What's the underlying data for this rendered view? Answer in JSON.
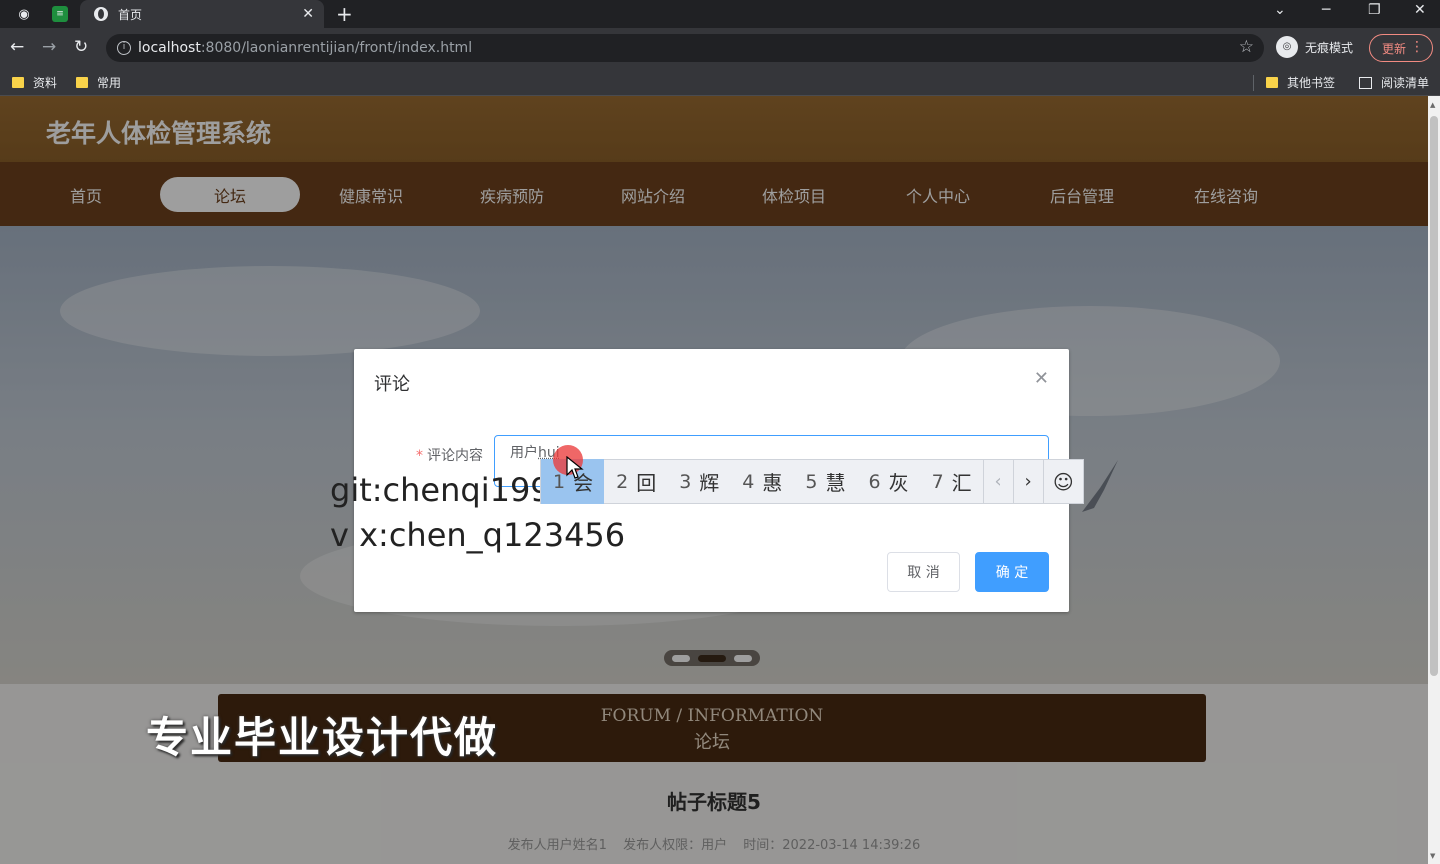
{
  "browser": {
    "tab_title": "首页",
    "url_host": "localhost",
    "url_path": ":8080/laonianrentijian/front/index.html",
    "incognito_label": "无痕模式",
    "update_label": "更新",
    "bookmarks": [
      "资料",
      "常用",
      "其他书签",
      "阅读清单"
    ]
  },
  "site": {
    "title": "老年人体检管理系统",
    "nav": [
      "首页",
      "论坛",
      "健康常识",
      "疾病预防",
      "网站介绍",
      "体检项目",
      "个人中心",
      "后台管理",
      "在线咨询"
    ],
    "active_nav": "论坛"
  },
  "forum": {
    "heading_en": "FORUM / INFORMATION",
    "heading_zh": "论坛",
    "post_title": "帖子标题5",
    "meta": {
      "publisher": "发布人用户姓名1",
      "role": "发布人权限：用户",
      "time": "时间：2022-03-14 14:39:26"
    }
  },
  "dialog": {
    "title": "评论",
    "label": "评论内容",
    "value_prefix": "用户",
    "value_composing": "hui",
    "cancel": "取 消",
    "confirm": "确 定"
  },
  "ime": {
    "candidates": [
      {
        "n": "1",
        "c": "会"
      },
      {
        "n": "2",
        "c": "回"
      },
      {
        "n": "3",
        "c": "辉"
      },
      {
        "n": "4",
        "c": "惠"
      },
      {
        "n": "5",
        "c": "慧"
      },
      {
        "n": "6",
        "c": "灰"
      },
      {
        "n": "7",
        "c": "汇"
      }
    ]
  },
  "overlay_text": {
    "git": "git:chenqi199",
    "vx": "v x:chen_q123456",
    "watermark": "专业毕业设计代做"
  },
  "colors": {
    "header": "#8c6029",
    "nav": "#6e421d",
    "primary": "#409eff"
  }
}
